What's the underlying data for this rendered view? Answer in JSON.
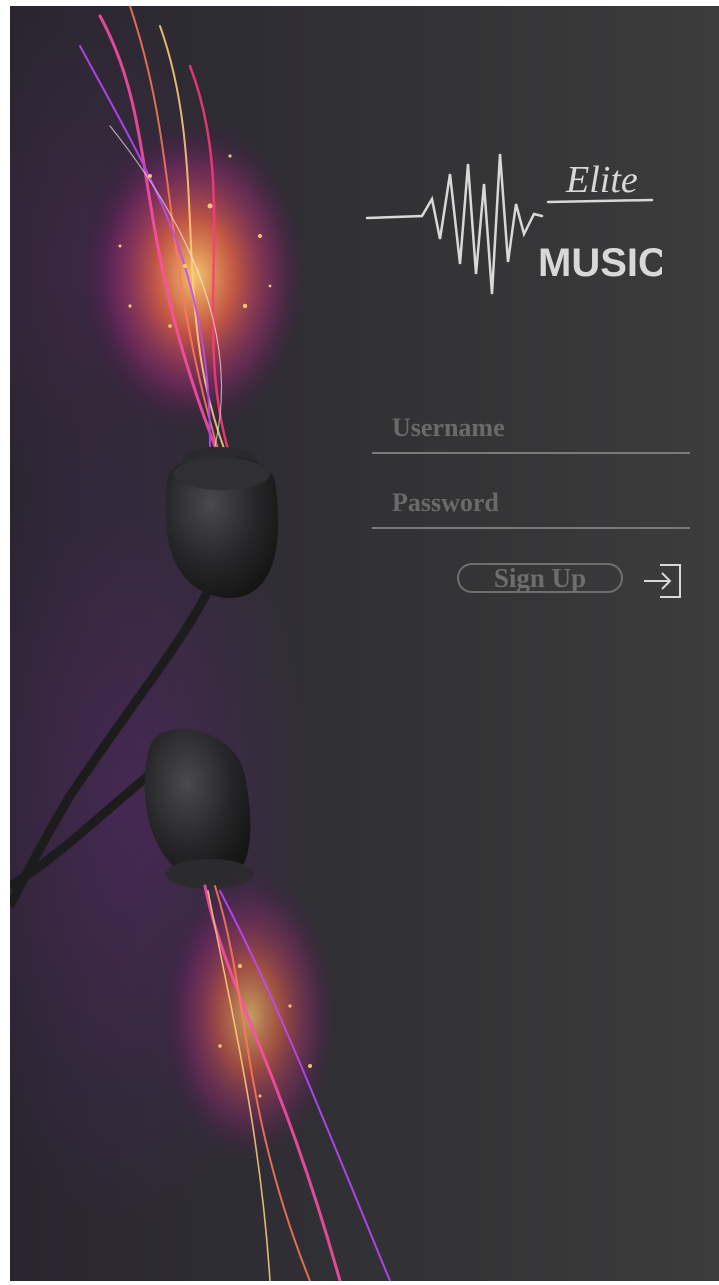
{
  "brand": {
    "script_word": "Elite",
    "main_word": "MUSIC",
    "logo_icon": "waveform-icon"
  },
  "form": {
    "username_placeholder": "Username",
    "password_placeholder": "Password",
    "signup_label": "Sign Up",
    "login_icon": "sign-in-arrow-icon"
  },
  "colors": {
    "background": "#333335",
    "field_text": "#6a6a6a",
    "logo": "#d8d8d8",
    "glow_magenta": "#ff3aa0",
    "glow_orange": "#ffb040"
  }
}
